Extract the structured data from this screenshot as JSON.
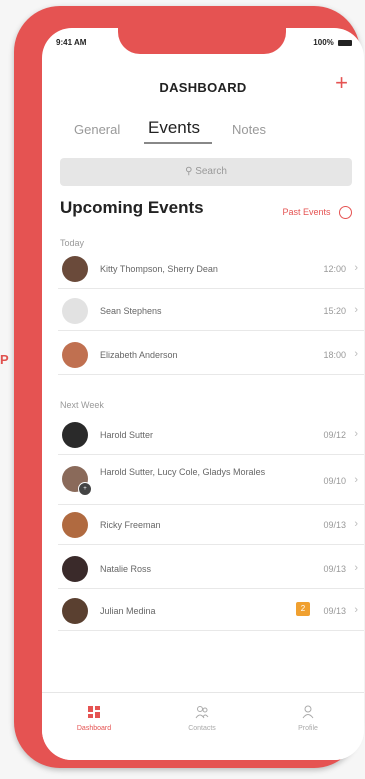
{
  "edge_glyph": "P",
  "status": {
    "time": "9:41 AM",
    "battery": "100%"
  },
  "header": {
    "title": "DASHBOARD",
    "add_icon": "+"
  },
  "tabs": [
    {
      "label": "General"
    },
    {
      "label": "Events"
    },
    {
      "label": "Notes"
    }
  ],
  "search": {
    "placeholder": "Search"
  },
  "section": {
    "title": "Upcoming Events",
    "past_events": "Past Events"
  },
  "groups": [
    {
      "label": "Today",
      "items": [
        {
          "name": "Kitty Thompson, Sherry Dean",
          "time": "12:00"
        },
        {
          "name": "Sean Stephens",
          "time": "15:20"
        },
        {
          "name": "Elizabeth Anderson",
          "time": "18:00"
        }
      ]
    },
    {
      "label": "Next Week",
      "items": [
        {
          "name": "Harold Sutter",
          "time": "09/12"
        },
        {
          "name": "Harold Sutter, Lucy Cole, Gladys Morales",
          "time": "09/10",
          "badge": "2"
        },
        {
          "name": "Ricky Freeman",
          "time": "09/13"
        },
        {
          "name": "Natalie Ross",
          "time": "09/13"
        },
        {
          "name": "Julian Medina",
          "time": "09/13",
          "badge": "2"
        }
      ]
    }
  ],
  "tabbar": [
    {
      "label": "Dashboard",
      "icon": "dashboard-icon"
    },
    {
      "label": "Contacts",
      "icon": "contacts-icon"
    },
    {
      "label": "Profile",
      "icon": "profile-icon"
    }
  ],
  "colors": {
    "accent": "#e55352",
    "badge": "#f0a030"
  }
}
